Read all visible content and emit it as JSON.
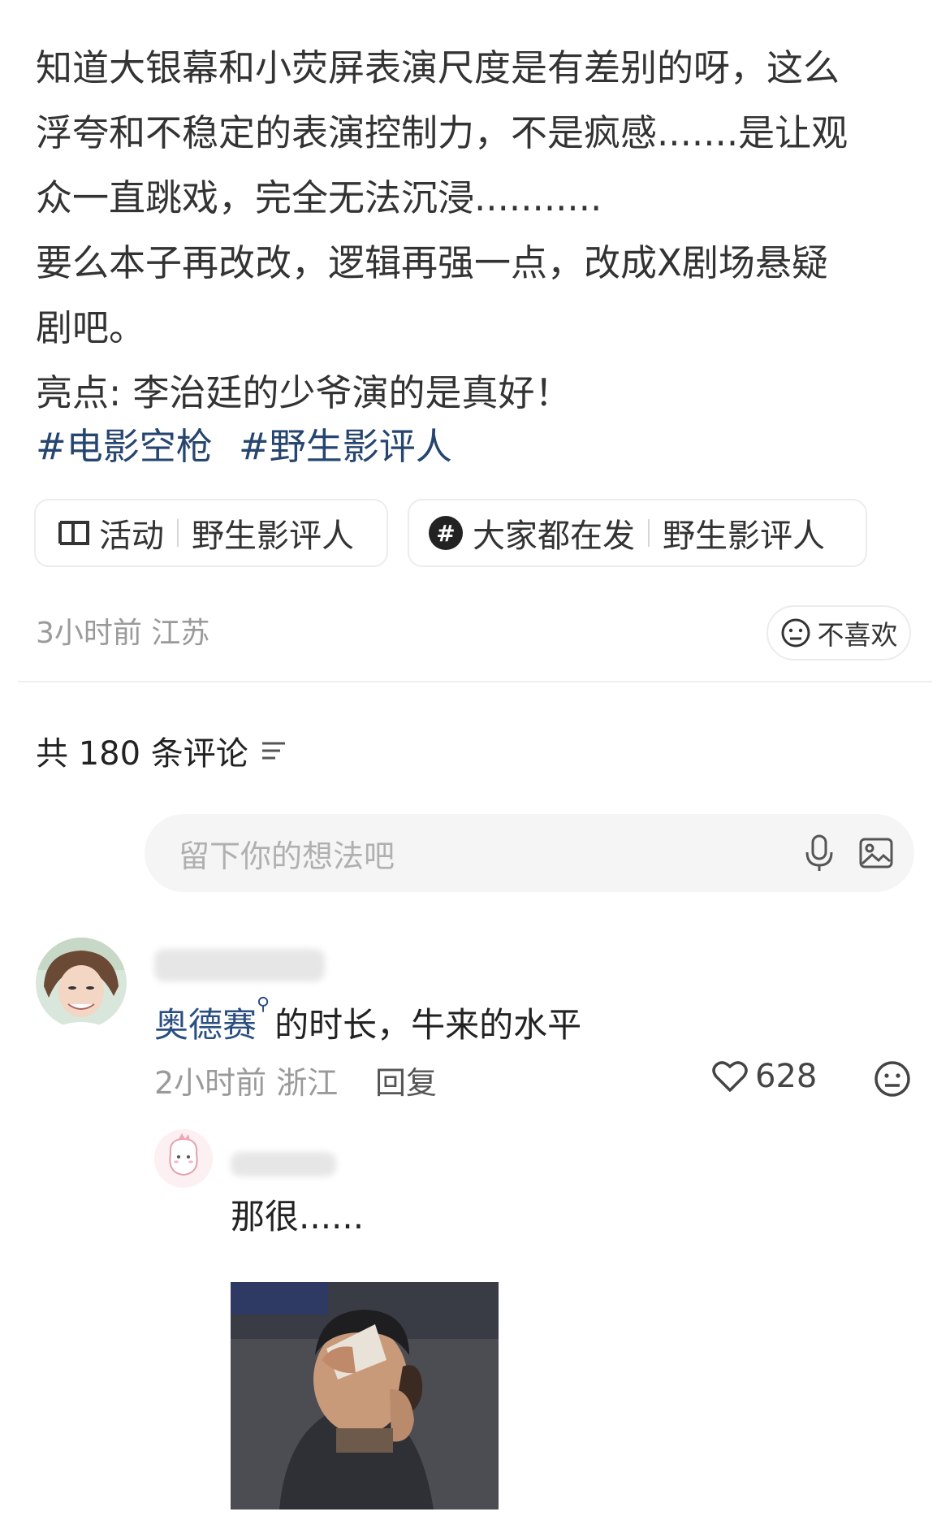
{
  "post": {
    "lines": [
      "知道大银幕和小荧屏表演尺度是有差别的呀，这么",
      "浮夸和不稳定的表演控制力，不是疯感.......是让观",
      "众一直跳戏，完全无法沉浸...........",
      "要么本子再改改，逻辑再强一点，改成X剧场悬疑",
      "剧吧。",
      "亮点: 李治廷的少爷演的是真好！"
    ],
    "hashtags": [
      "#电影空枪",
      "#野生影评人"
    ],
    "chips": [
      {
        "icon": "activity-icon",
        "label": "活动",
        "value": "野生影评人"
      },
      {
        "icon": "hashtag-icon",
        "label": "大家都在发",
        "value": "野生影评人"
      }
    ],
    "meta": "3小时前 江苏",
    "dislike_label": "不喜欢"
  },
  "comments_header": {
    "title": "共 180 条评论"
  },
  "input": {
    "placeholder": "留下你的想法吧"
  },
  "comments": [
    {
      "link_text": "奥德赛",
      "text": "的时长，牛来的水平",
      "meta": "2小时前 浙江",
      "reply_label": "回复",
      "likes": "628"
    }
  ],
  "replies": [
    {
      "text": "那很......"
    }
  ],
  "colors": {
    "link": "#2a4e82",
    "hashtag": "#26456f",
    "muted": "#9a9a9a"
  }
}
